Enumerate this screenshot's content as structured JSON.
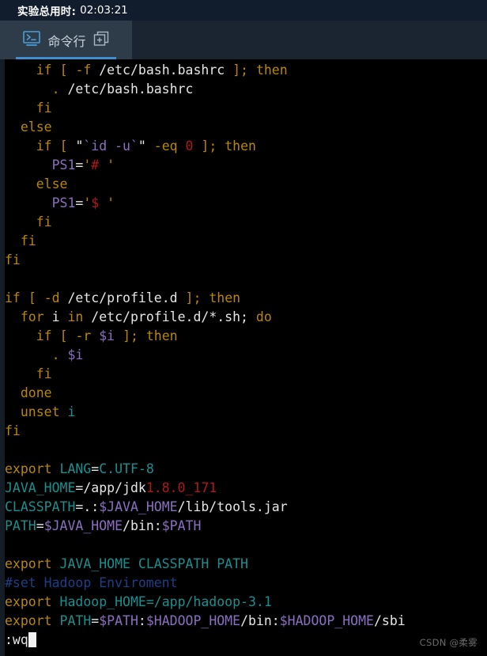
{
  "header": {
    "timer_label": "实验总用时:",
    "timer_value": "02:03:21"
  },
  "tabs": [
    {
      "label": "命令行",
      "terminal_icon": "terminal-icon",
      "duplicate_icon": "duplicate-add-icon",
      "active": true,
      "accent_color": "#3d8fd1"
    }
  ],
  "colors": {
    "timer_bar_bg": "#111c2c",
    "tab_strip_bg": "#1b2531",
    "tab_active_bg": "#2e3b49",
    "terminal_bg": "#000000",
    "left_gutter": "#141c26",
    "keyword": "#b8860b",
    "plain": "#e6e6e6",
    "variable": "#8b6fc0",
    "number": "#b01818",
    "env_name": "#1a8f8f",
    "comment": "#1d3f87",
    "cursor": "#f2f2f2"
  },
  "terminal": {
    "editor": "vi",
    "status_command": ":wq",
    "cursor_visible": true,
    "lines": [
      {
        "id": "l1",
        "tokens": [
          {
            "t": "    ",
            "c": "plain"
          },
          {
            "t": "if",
            "c": "kw"
          },
          {
            "t": " ",
            "c": "plain"
          },
          {
            "t": "[",
            "c": "kw"
          },
          {
            "t": " ",
            "c": "plain"
          },
          {
            "t": "-f",
            "c": "kw"
          },
          {
            "t": " /etc/bash.bashrc ",
            "c": "plain"
          },
          {
            "t": "];",
            "c": "kw"
          },
          {
            "t": " ",
            "c": "plain"
          },
          {
            "t": "then",
            "c": "kw"
          }
        ]
      },
      {
        "id": "l2",
        "tokens": [
          {
            "t": "      ",
            "c": "plain"
          },
          {
            "t": ".",
            "c": "kw"
          },
          {
            "t": " /etc/bash.bashrc",
            "c": "plain"
          }
        ]
      },
      {
        "id": "l3",
        "tokens": [
          {
            "t": "    ",
            "c": "plain"
          },
          {
            "t": "fi",
            "c": "kw"
          }
        ]
      },
      {
        "id": "l4",
        "tokens": [
          {
            "t": "  ",
            "c": "plain"
          },
          {
            "t": "else",
            "c": "kw"
          }
        ]
      },
      {
        "id": "l5",
        "tokens": [
          {
            "t": "    ",
            "c": "plain"
          },
          {
            "t": "if",
            "c": "kw"
          },
          {
            "t": " ",
            "c": "plain"
          },
          {
            "t": "[",
            "c": "kw"
          },
          {
            "t": " ",
            "c": "plain"
          },
          {
            "t": "\"",
            "c": "plain"
          },
          {
            "t": "`id -u`",
            "c": "var"
          },
          {
            "t": "\"",
            "c": "plain"
          },
          {
            "t": " ",
            "c": "plain"
          },
          {
            "t": "-eq",
            "c": "kw"
          },
          {
            "t": " ",
            "c": "plain"
          },
          {
            "t": "0",
            "c": "num"
          },
          {
            "t": " ",
            "c": "plain"
          },
          {
            "t": "];",
            "c": "kw"
          },
          {
            "t": " ",
            "c": "plain"
          },
          {
            "t": "then",
            "c": "kw"
          }
        ]
      },
      {
        "id": "l6",
        "tokens": [
          {
            "t": "      ",
            "c": "plain"
          },
          {
            "t": "PS1",
            "c": "var"
          },
          {
            "t": "=",
            "c": "plain"
          },
          {
            "t": "'",
            "c": "kw"
          },
          {
            "t": "#",
            "c": "num"
          },
          {
            "t": " ",
            "c": "plain"
          },
          {
            "t": "'",
            "c": "kw"
          }
        ]
      },
      {
        "id": "l7",
        "tokens": [
          {
            "t": "    ",
            "c": "plain"
          },
          {
            "t": "else",
            "c": "kw"
          }
        ]
      },
      {
        "id": "l8",
        "tokens": [
          {
            "t": "      ",
            "c": "plain"
          },
          {
            "t": "PS1",
            "c": "var"
          },
          {
            "t": "=",
            "c": "plain"
          },
          {
            "t": "'",
            "c": "kw"
          },
          {
            "t": "$",
            "c": "num"
          },
          {
            "t": " ",
            "c": "plain"
          },
          {
            "t": "'",
            "c": "kw"
          }
        ]
      },
      {
        "id": "l9",
        "tokens": [
          {
            "t": "    ",
            "c": "plain"
          },
          {
            "t": "fi",
            "c": "kw"
          }
        ]
      },
      {
        "id": "l10",
        "tokens": [
          {
            "t": "  ",
            "c": "plain"
          },
          {
            "t": "fi",
            "c": "kw"
          }
        ]
      },
      {
        "id": "l11",
        "tokens": [
          {
            "t": "fi",
            "c": "kw"
          }
        ]
      },
      {
        "id": "l12",
        "tokens": []
      },
      {
        "id": "l13",
        "tokens": [
          {
            "t": "if",
            "c": "kw"
          },
          {
            "t": " ",
            "c": "plain"
          },
          {
            "t": "[",
            "c": "kw"
          },
          {
            "t": " ",
            "c": "plain"
          },
          {
            "t": "-d",
            "c": "kw"
          },
          {
            "t": " /etc/profile.d ",
            "c": "plain"
          },
          {
            "t": "];",
            "c": "kw"
          },
          {
            "t": " ",
            "c": "plain"
          },
          {
            "t": "then",
            "c": "kw"
          }
        ]
      },
      {
        "id": "l14",
        "tokens": [
          {
            "t": "  ",
            "c": "plain"
          },
          {
            "t": "for",
            "c": "kw"
          },
          {
            "t": " i ",
            "c": "plain"
          },
          {
            "t": "in",
            "c": "kw"
          },
          {
            "t": " /etc/profile.d/*.sh; ",
            "c": "plain"
          },
          {
            "t": "do",
            "c": "kw"
          }
        ]
      },
      {
        "id": "l15",
        "tokens": [
          {
            "t": "    ",
            "c": "plain"
          },
          {
            "t": "if",
            "c": "kw"
          },
          {
            "t": " ",
            "c": "plain"
          },
          {
            "t": "[",
            "c": "kw"
          },
          {
            "t": " ",
            "c": "plain"
          },
          {
            "t": "-r",
            "c": "kw"
          },
          {
            "t": " ",
            "c": "plain"
          },
          {
            "t": "$i",
            "c": "var"
          },
          {
            "t": " ",
            "c": "plain"
          },
          {
            "t": "];",
            "c": "kw"
          },
          {
            "t": " ",
            "c": "plain"
          },
          {
            "t": "then",
            "c": "kw"
          }
        ]
      },
      {
        "id": "l16",
        "tokens": [
          {
            "t": "      ",
            "c": "plain"
          },
          {
            "t": ".",
            "c": "kw"
          },
          {
            "t": " ",
            "c": "plain"
          },
          {
            "t": "$i",
            "c": "var"
          }
        ]
      },
      {
        "id": "l17",
        "tokens": [
          {
            "t": "    ",
            "c": "plain"
          },
          {
            "t": "fi",
            "c": "kw"
          }
        ]
      },
      {
        "id": "l18",
        "tokens": [
          {
            "t": "  ",
            "c": "plain"
          },
          {
            "t": "done",
            "c": "kw"
          }
        ]
      },
      {
        "id": "l19",
        "tokens": [
          {
            "t": "  ",
            "c": "plain"
          },
          {
            "t": "unset",
            "c": "kw"
          },
          {
            "t": " ",
            "c": "plain"
          },
          {
            "t": "i",
            "c": "env"
          }
        ]
      },
      {
        "id": "l20",
        "tokens": [
          {
            "t": "fi",
            "c": "kw"
          }
        ]
      },
      {
        "id": "l21",
        "tokens": []
      },
      {
        "id": "l22",
        "tokens": [
          {
            "t": "export",
            "c": "kw"
          },
          {
            "t": " ",
            "c": "plain"
          },
          {
            "t": "LANG",
            "c": "env"
          },
          {
            "t": "=",
            "c": "plain"
          },
          {
            "t": "C.UTF-8",
            "c": "env"
          }
        ]
      },
      {
        "id": "l23",
        "tokens": [
          {
            "t": "JAVA_HOME",
            "c": "env"
          },
          {
            "t": "=/app/jdk",
            "c": "plain"
          },
          {
            "t": "1.8.0_171",
            "c": "num"
          }
        ]
      },
      {
        "id": "l24",
        "tokens": [
          {
            "t": "CLASSPATH",
            "c": "env"
          },
          {
            "t": "=.:",
            "c": "plain"
          },
          {
            "t": "$JAVA_HOME",
            "c": "var"
          },
          {
            "t": "/lib/tools.jar",
            "c": "plain"
          }
        ]
      },
      {
        "id": "l25",
        "tokens": [
          {
            "t": "PATH",
            "c": "env"
          },
          {
            "t": "=",
            "c": "plain"
          },
          {
            "t": "$JAVA_HOME",
            "c": "var"
          },
          {
            "t": "/bin:",
            "c": "plain"
          },
          {
            "t": "$PATH",
            "c": "var"
          }
        ]
      },
      {
        "id": "l26",
        "tokens": []
      },
      {
        "id": "l27",
        "tokens": [
          {
            "t": "export",
            "c": "kw"
          },
          {
            "t": " ",
            "c": "plain"
          },
          {
            "t": "JAVA_HOME CLASSPATH PATH",
            "c": "env"
          }
        ]
      },
      {
        "id": "l28",
        "tokens": [
          {
            "t": "#set Hadoop Enviroment",
            "c": "cmt"
          }
        ]
      },
      {
        "id": "l29",
        "tokens": [
          {
            "t": "export",
            "c": "kw"
          },
          {
            "t": " ",
            "c": "plain"
          },
          {
            "t": "Hadoop_HOME",
            "c": "env"
          },
          {
            "t": "=",
            "c": "env"
          },
          {
            "t": "/app/hadoop-3.1",
            "c": "env"
          }
        ]
      },
      {
        "id": "l30",
        "tokens": [
          {
            "t": "export",
            "c": "kw"
          },
          {
            "t": " ",
            "c": "plain"
          },
          {
            "t": "PATH",
            "c": "env"
          },
          {
            "t": "=",
            "c": "plain"
          },
          {
            "t": "$PATH",
            "c": "var"
          },
          {
            "t": ":",
            "c": "plain"
          },
          {
            "t": "$HADOOP_HOME",
            "c": "var"
          },
          {
            "t": "/bin:",
            "c": "plain"
          },
          {
            "t": "$HADOOP_HOME",
            "c": "var"
          },
          {
            "t": "/sbi",
            "c": "plain"
          }
        ]
      }
    ]
  },
  "watermark": "CSDN @柔雾"
}
